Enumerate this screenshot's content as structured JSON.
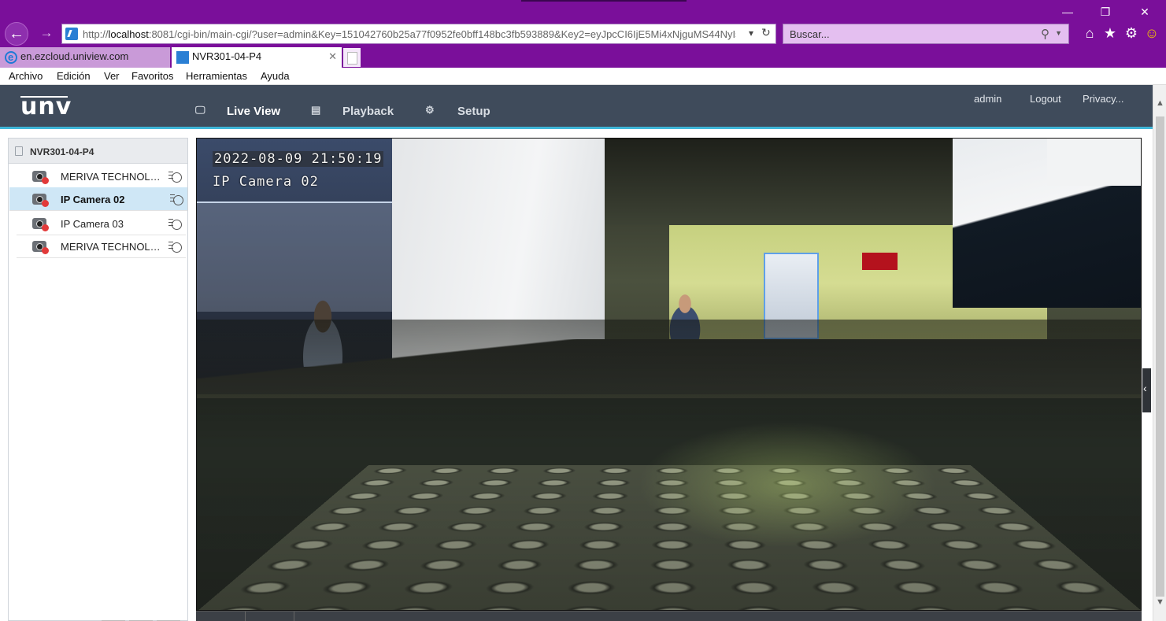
{
  "browser": {
    "window_controls": {
      "minimize": "—",
      "restore": "❐",
      "close": "✕"
    },
    "address": {
      "prefix": "http://",
      "host": "localhost",
      "rest": ":8081/cgi-bin/main-cgi/?user=admin&Key=151042760b25a77f0952fe0bff148bc3fb593889&Key2=eyJpcCI6IjE5Mi4xNjguMS44NyIsInl"
    },
    "search_placeholder": "Buscar...",
    "tabs": [
      {
        "label": "en.ezcloud.uniview.com"
      },
      {
        "label": "NVR301-04-P4"
      }
    ],
    "menu": [
      "Archivo",
      "Edición",
      "Ver",
      "Favoritos",
      "Herramientas",
      "Ayuda"
    ]
  },
  "app": {
    "logo": "unv",
    "nav": [
      {
        "label": "Live View",
        "icon": "monitor-icon"
      },
      {
        "label": "Playback",
        "icon": "film-icon"
      },
      {
        "label": "Setup",
        "icon": "gear-icon"
      }
    ],
    "header_links": [
      "admin",
      "Logout",
      "Privacy..."
    ]
  },
  "devices": {
    "nvr_name": "NVR301-04-P4",
    "cameras": [
      {
        "name": "MERIVA TECHNOLO...",
        "selected": false
      },
      {
        "name": "IP Camera 02",
        "selected": true
      },
      {
        "name": "IP Camera 03",
        "selected": false
      },
      {
        "name": "MERIVA TECHNOLO...",
        "selected": false
      }
    ]
  },
  "video": {
    "timestamp": "2022-08-09 21:50:19",
    "camera_label": "IP Camera 02"
  }
}
